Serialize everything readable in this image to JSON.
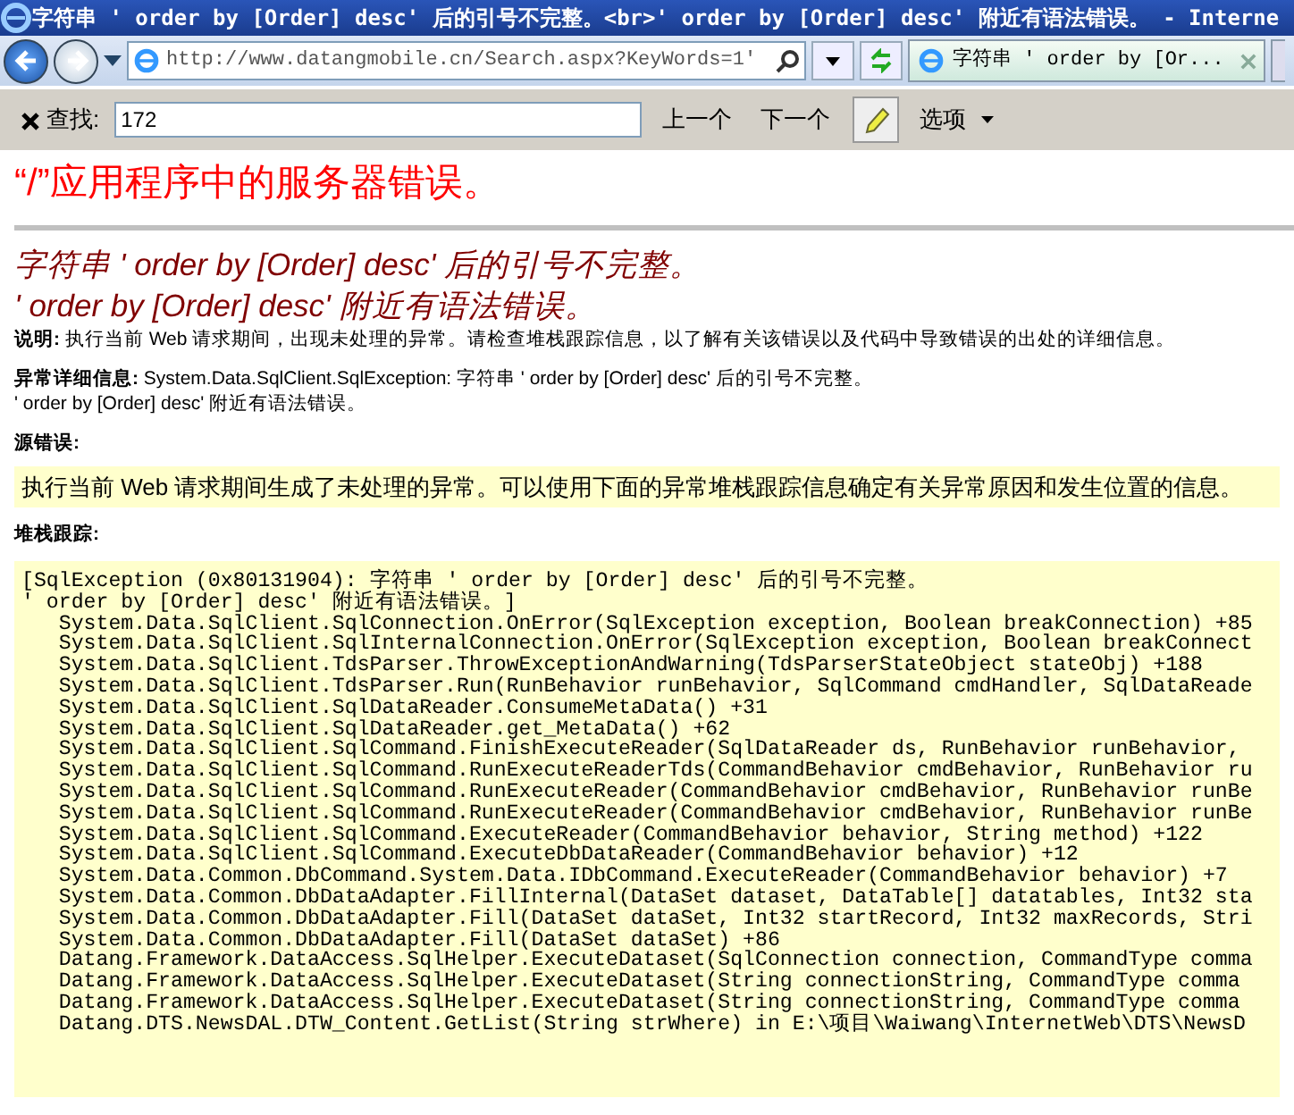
{
  "window": {
    "title": "字符串 ' order by [Order] desc' 后的引号不完整。<br>' order by [Order] desc' 附近有语法错误。 - Interne"
  },
  "toolbar": {
    "address": "http://www.datangmobile.cn/Search.aspx?KeyWords=1'",
    "tabs": [
      {
        "label": "字符串 ' order by [Or...",
        "selected": true
      }
    ]
  },
  "find_bar": {
    "label": "查找:",
    "value": "172",
    "buttons": [
      "上一个",
      "下一个"
    ],
    "options": "选项"
  },
  "page": {
    "heading": "“/”应用程序中的服务器错误。",
    "error_title": [
      "字符串 ' order by [Order] desc' 后的引号不完整。",
      "' order by [Order] desc' 附近有语法错误。"
    ],
    "description": "**说明:** 执行当前 Web 请求期间，出现未处理的异常。请检查堆栈跟踪信息，以了解有关该错误以及代码中导致错误的出处的详细信息。",
    "exception_details": [
      "**异常详细信息:** System.Data.SqlClient.SqlException: 字符串 ' order by [Order] desc' 后的引号不完整。",
      "' order by [Order] desc' 附近有语法错误。"
    ],
    "source_error": {
      "label": "源错误:",
      "text": "执行当前 Web 请求期间生成了未处理的异常。可以使用下面的异常堆栈跟踪信息确定有关异常原因和发生位置的信息。"
    },
    "stack_trace": {
      "label": "堆栈跟踪:",
      "lines": [
        "[SqlException (0x80131904): 字符串 ' order by [Order] desc' 后的引号不完整。",
        "' order by [Order] desc' 附近有语法错误。]",
        "   System.Data.SqlClient.SqlConnection.OnError(SqlException exception, Boolean breakConnection) +85",
        "   System.Data.SqlClient.SqlInternalConnection.OnError(SqlException exception, Boolean breakConnect",
        "   System.Data.SqlClient.TdsParser.ThrowExceptionAndWarning(TdsParserStateObject stateObj) +188",
        "   System.Data.SqlClient.TdsParser.Run(RunBehavior runBehavior, SqlCommand cmdHandler, SqlDataReade",
        "   System.Data.SqlClient.SqlDataReader.ConsumeMetaData() +31",
        "   System.Data.SqlClient.SqlDataReader.get_MetaData() +62",
        "   System.Data.SqlClient.SqlCommand.FinishExecuteReader(SqlDataReader ds, RunBehavior runBehavior,",
        "   System.Data.SqlClient.SqlCommand.RunExecuteReaderTds(CommandBehavior cmdBehavior, RunBehavior ru",
        "   System.Data.SqlClient.SqlCommand.RunExecuteReader(CommandBehavior cmdBehavior, RunBehavior runBe",
        "   System.Data.SqlClient.SqlCommand.RunExecuteReader(CommandBehavior cmdBehavior, RunBehavior runBe",
        "   System.Data.SqlClient.SqlCommand.ExecuteReader(CommandBehavior behavior, String method) +122",
        "   System.Data.SqlClient.SqlCommand.ExecuteDbDataReader(CommandBehavior behavior) +12",
        "   System.Data.Common.DbCommand.System.Data.IDbCommand.ExecuteReader(CommandBehavior behavior) +7",
        "   System.Data.Common.DbDataAdapter.FillInternal(DataSet dataset, DataTable[] datatables, Int32 sta",
        "   System.Data.Common.DbDataAdapter.Fill(DataSet dataSet, Int32 startRecord, Int32 maxRecords, Stri",
        "   System.Data.Common.DbDataAdapter.Fill(DataSet dataSet) +86",
        "   Datang.Framework.DataAccess.SqlHelper.ExecuteDataset(SqlConnection connection, CommandType comma",
        "   Datang.Framework.DataAccess.SqlHelper.ExecuteDataset(String connectionString, CommandType comma",
        "   Datang.Framework.DataAccess.SqlHelper.ExecuteDataset(String connectionString, CommandType comma",
        "   Datang.DTS.NewsDAL.DTW_Content.GetList(String strWhere) in E:\\项目\\Waiwang\\InternetWeb\\DTS\\NewsD"
      ]
    }
  }
}
